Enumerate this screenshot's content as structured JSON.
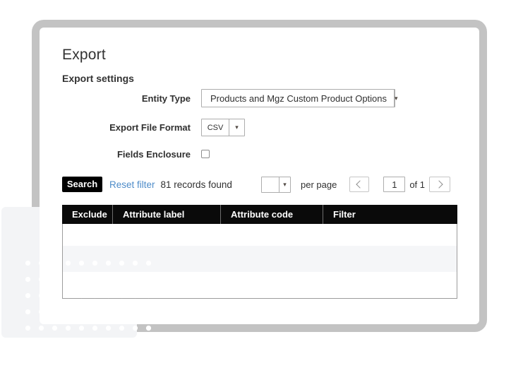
{
  "page": {
    "title": "Export",
    "subtitle": "Export settings"
  },
  "form": {
    "entity_type": {
      "label": "Entity Type",
      "value": "Products and Mgz Custom Product Options"
    },
    "file_format": {
      "label": "Export File Format",
      "value": "CSV"
    },
    "fields_enclosure": {
      "label": "Fields Enclosure",
      "checked": false
    }
  },
  "grid_toolbar": {
    "search_label": "Search",
    "reset_filter_label": "Reset filter",
    "records_text": "81 records found",
    "per_page": {
      "value": "",
      "label": "per page"
    },
    "pagination": {
      "current_page": "1",
      "of_text": "of 1"
    }
  },
  "table": {
    "headers": [
      "Exclude",
      "Attribute label",
      "Attribute code",
      "Filter"
    ],
    "row_count": 3
  },
  "icons": {
    "dropdown_caret": "▾",
    "chevron_left": "css-shape",
    "chevron_right": "css-shape",
    "checkbox_unchecked": "css-shape"
  },
  "colors": {
    "header_bg": "#0a0a0a",
    "search_button_bg": "#000000",
    "link_blue": "#4e8cc9",
    "frame_gray": "#c3c3c3",
    "decor_panel": "#f3f4f6",
    "alt_row": "#f5f6f8",
    "input_border": "#adadad"
  }
}
